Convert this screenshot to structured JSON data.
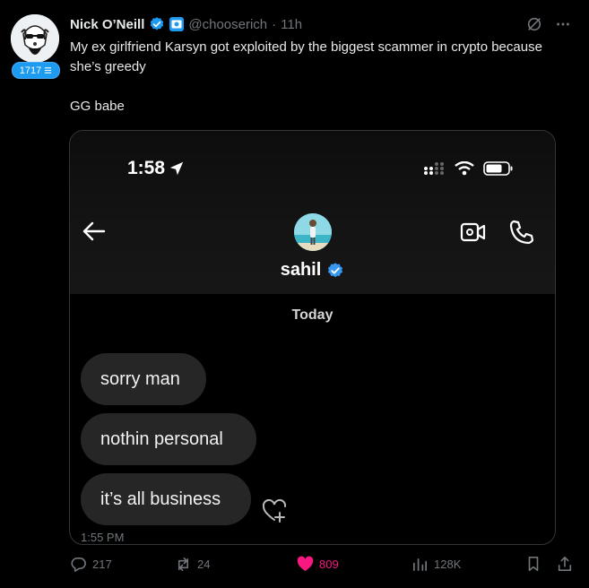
{
  "author": {
    "name": "Nick O’Neill",
    "handle": "@chooserich",
    "separator": "·",
    "time": "11h",
    "level_badge": "1717"
  },
  "tweet": {
    "text_line1": "My ex girlfriend Karsyn got exploited by the biggest scammer in crypto because she’s greedy",
    "text_line2": "GG babe"
  },
  "media": {
    "status_time": "1:58",
    "contact_name": "sahil",
    "day_label": "Today",
    "messages": [
      {
        "text": "sorry man"
      },
      {
        "text": "nothin personal"
      },
      {
        "text": "it’s all business"
      }
    ],
    "message_time": "1:55 PM"
  },
  "actions": {
    "replies": "217",
    "reposts": "24",
    "likes": "809",
    "views": "128K"
  },
  "colors": {
    "accent": "#1d9bf0",
    "like": "#f91880",
    "muted": "#71767b",
    "bubble": "#262626"
  },
  "icons": [
    "grok-icon",
    "more-icon",
    "verified-badge-icon",
    "reply-icon",
    "repost-icon",
    "heart-icon",
    "views-icon",
    "bookmark-icon",
    "share-icon",
    "back-arrow-icon",
    "video-call-icon",
    "phone-icon",
    "location-arrow-icon",
    "signal-icon",
    "wifi-icon",
    "battery-icon",
    "heart-add-icon"
  ]
}
